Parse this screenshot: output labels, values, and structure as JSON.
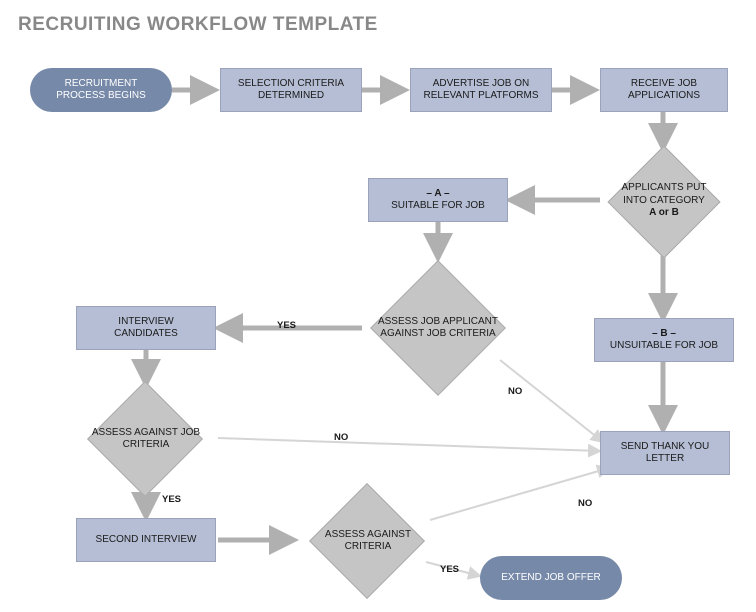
{
  "title": "RECRUITING WORKFLOW TEMPLATE",
  "nodes": {
    "start": "RECRUITMENT PROCESS BEGINS",
    "criteria": "SELECTION CRITERIA DETERMINED",
    "advertise": "ADVERTISE JOB ON RELEVANT PLATFORMS",
    "receive": "RECEIVE JOB APPLICATIONS",
    "category": "APPLICANTS PUT INTO CATEGORY",
    "category_sub": "A or B",
    "cat_a_top": "– A –",
    "cat_a": "SUITABLE FOR JOB",
    "cat_b_top": "– B –",
    "cat_b": "UNSUITABLE FOR JOB",
    "assess1": "ASSESS JOB APPLICANT AGAINST JOB CRITERIA",
    "interview": "INTERVIEW CANDIDATES",
    "assess2": "ASSESS AGAINST JOB CRITERIA",
    "second": "SECOND INTERVIEW",
    "assess3": "ASSESS AGAINST CRITERIA",
    "thankyou": "SEND THANK YOU LETTER",
    "offer": "EXTEND JOB OFFER"
  },
  "labels": {
    "yes1": "YES",
    "no1": "NO",
    "yes2": "YES",
    "no2": "NO",
    "yes3": "YES",
    "no3": "NO"
  }
}
